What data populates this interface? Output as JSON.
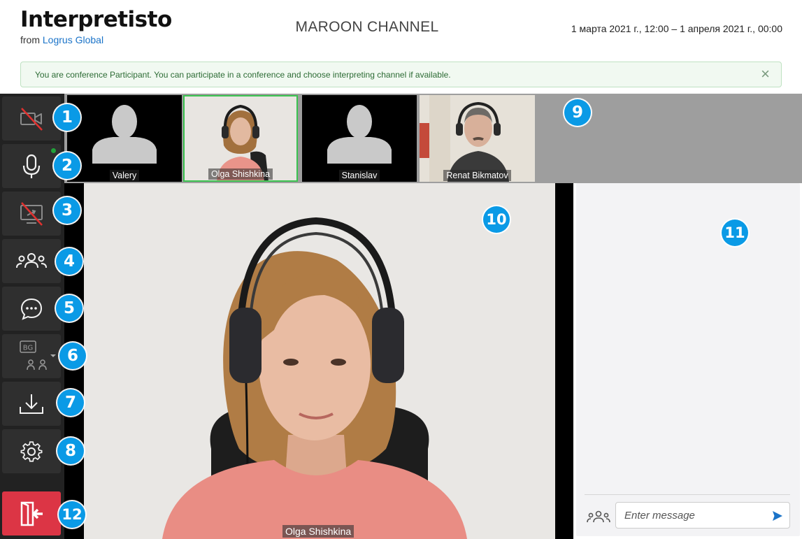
{
  "header": {
    "app_title": "Interpretisto",
    "from_prefix": "from",
    "from_link": "Logrus Global",
    "channel": "MAROON CHANNEL",
    "date_range": "1 марта 2021 г., 12:00 – 1 апреля 2021 г., 00:00"
  },
  "alert": {
    "message": "You are conference Participant. You can participate in a conference and choose interpreting channel if available.",
    "close": "×"
  },
  "sidebar": {
    "buttons": [
      {
        "icon": "camera-off-icon",
        "state": "off"
      },
      {
        "icon": "microphone-icon",
        "state": "on"
      },
      {
        "icon": "screen-share-off-icon",
        "state": "off"
      },
      {
        "icon": "participants-icon"
      },
      {
        "icon": "chat-icon"
      },
      {
        "icon": "language-channel-icon",
        "language_code": "BG"
      },
      {
        "icon": "download-icon"
      },
      {
        "icon": "settings-gear-icon"
      },
      {
        "icon": "exit-door-icon",
        "accent": "#dc3545"
      }
    ]
  },
  "participants": [
    {
      "name": "Valery",
      "video": false
    },
    {
      "name": "Olga Shishkina",
      "video": true,
      "active": true
    },
    {
      "name": "Stanislav",
      "video": false
    },
    {
      "name": "Renat Bikmatov",
      "video": true
    }
  ],
  "main_video": {
    "name": "Olga Shishkina"
  },
  "chat": {
    "placeholder": "Enter message",
    "send_icon": "send-icon"
  },
  "callouts": [
    "1",
    "2",
    "3",
    "4",
    "5",
    "6",
    "7",
    "8",
    "9",
    "10",
    "11",
    "12"
  ],
  "colors": {
    "accent": "#0a9ae6",
    "active_border": "#3ac24f",
    "exit": "#dc3545",
    "sidebar": "#222222"
  }
}
